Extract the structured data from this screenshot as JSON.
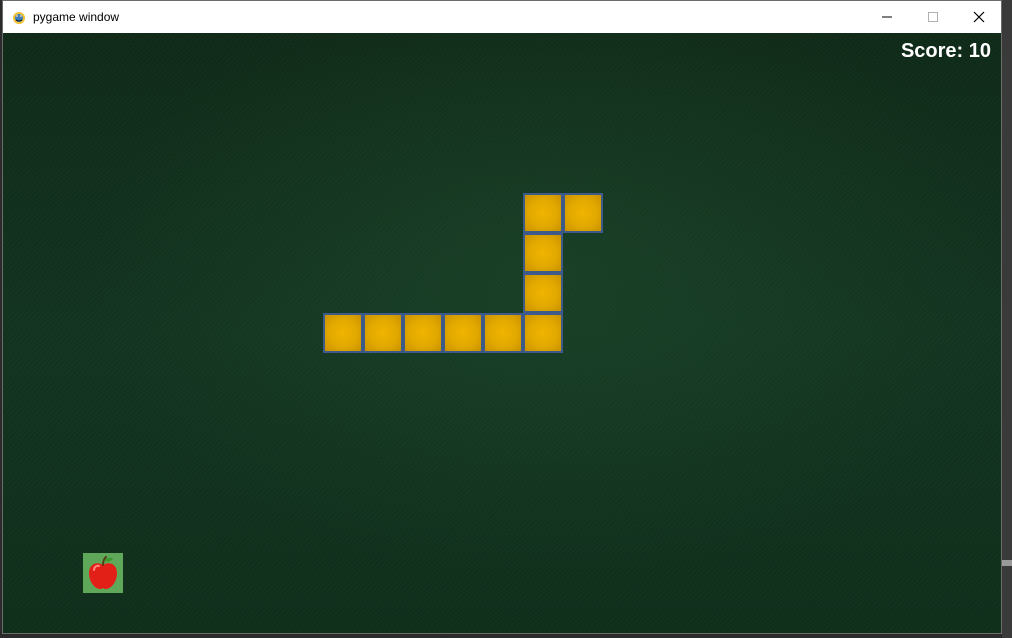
{
  "window": {
    "title": "pygame window",
    "minimize_symbol": "—",
    "maximize_symbol": "☐",
    "close_symbol": "✕"
  },
  "game": {
    "score_text": "Score: 10",
    "grid_cell_size": 40,
    "snake": [
      {
        "col": 13,
        "row": 4
      },
      {
        "col": 14,
        "row": 4
      },
      {
        "col": 13,
        "row": 5
      },
      {
        "col": 13,
        "row": 6
      },
      {
        "col": 8,
        "row": 7
      },
      {
        "col": 9,
        "row": 7
      },
      {
        "col": 10,
        "row": 7
      },
      {
        "col": 11,
        "row": 7
      },
      {
        "col": 12,
        "row": 7
      },
      {
        "col": 13,
        "row": 7
      }
    ],
    "apple": {
      "col": 2,
      "row": 13,
      "icon": "apple-icon"
    },
    "colors": {
      "snake_fill": "#e1a800",
      "snake_border": "#3c5a8a",
      "background": "#123420",
      "apple_tile": "#5fa85a",
      "apple_red": "#e32018"
    }
  }
}
